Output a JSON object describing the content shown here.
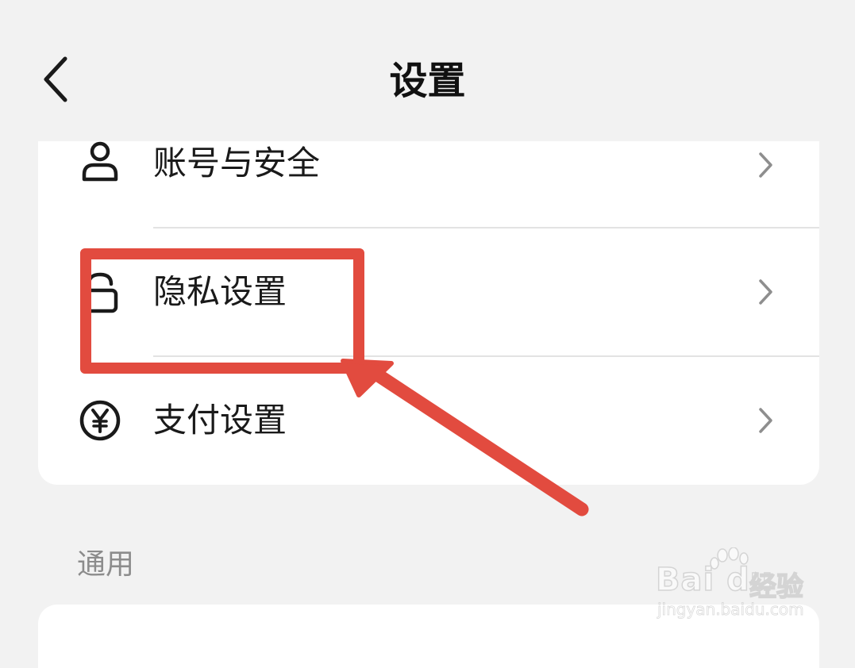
{
  "header": {
    "title": "设置",
    "back_icon": "chevron-left-icon"
  },
  "security_section": {
    "items": [
      {
        "label": "账号与安全",
        "icon": "user-icon"
      },
      {
        "label": "隐私设置",
        "icon": "lock-icon"
      },
      {
        "label": "支付设置",
        "icon": "yen-circle-icon"
      }
    ]
  },
  "general_section": {
    "header": "通用"
  },
  "annotation": {
    "highlight_color": "#e24b3f",
    "highlighted_item": "隐私设置"
  },
  "watermark": {
    "logo_text": "Bai du",
    "suffix_text": "经验",
    "url": "jingyan.baidu.com"
  }
}
